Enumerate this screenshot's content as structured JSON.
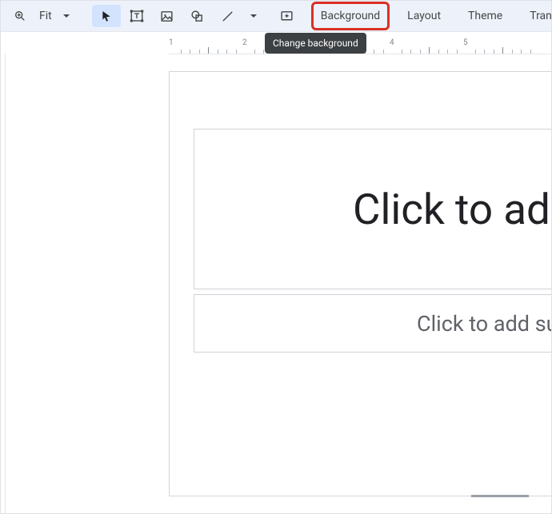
{
  "toolbar": {
    "zoom_label": "Fit",
    "btn_background": "Background",
    "btn_layout": "Layout",
    "btn_theme": "Theme",
    "btn_transition": "Transition"
  },
  "tooltip": {
    "background": "Change background"
  },
  "slide": {
    "title_placeholder": "Click to add title",
    "subtitle_placeholder": "Click to add subtitle"
  },
  "ruler": {
    "start": 1,
    "end": 5
  }
}
